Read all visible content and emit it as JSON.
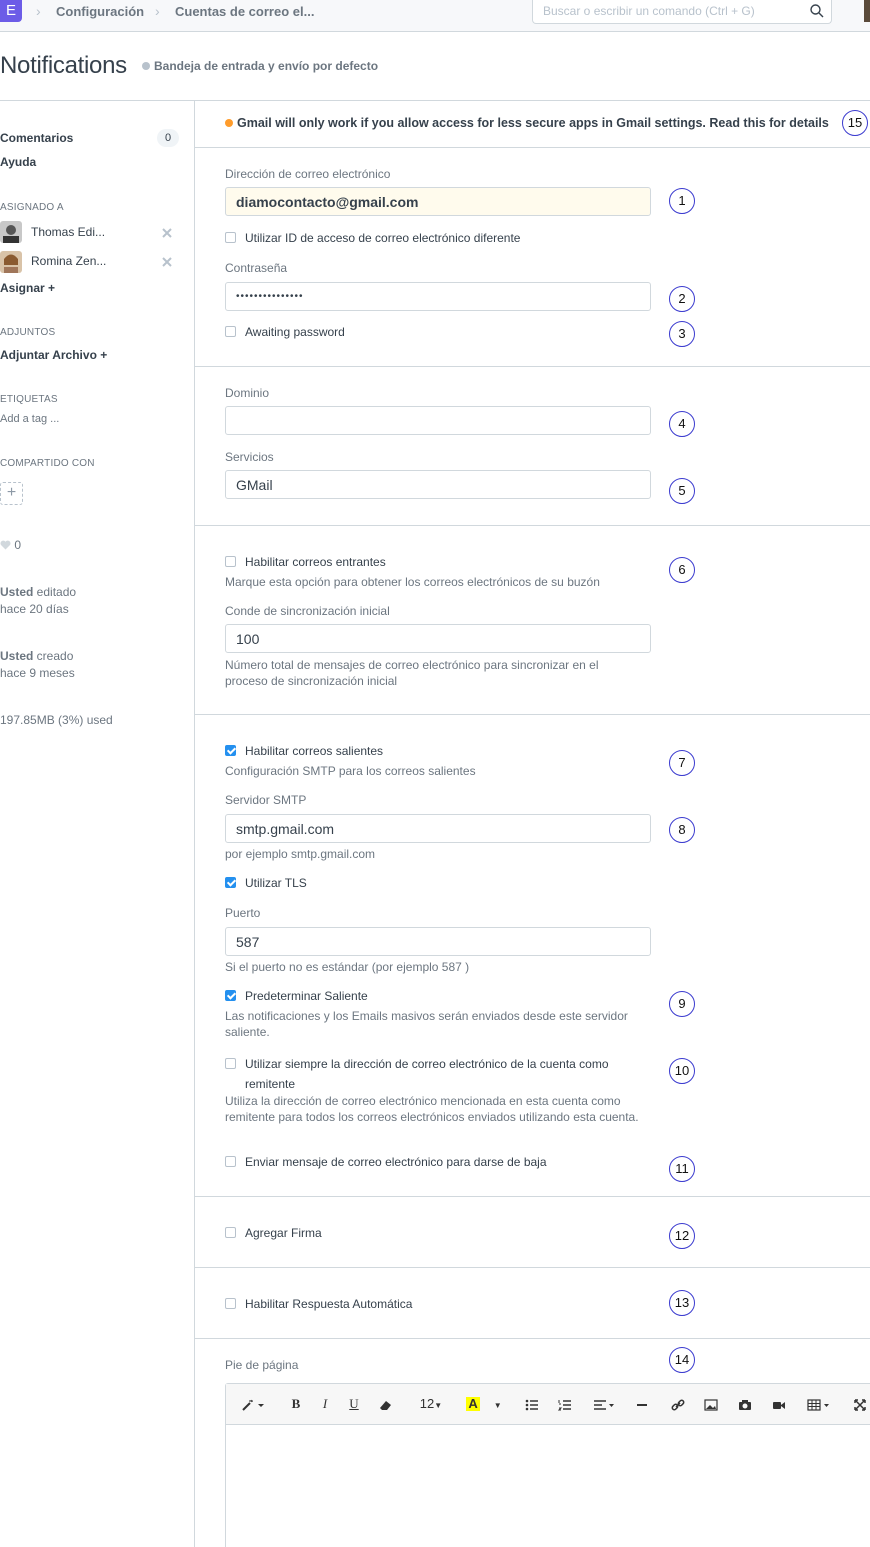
{
  "navbar": {
    "logo": "E",
    "breadcrumbs": [
      "Configuración",
      "Cuentas de correo el..."
    ],
    "search_placeholder": "Buscar o escribir un comando (Ctrl + G)"
  },
  "header": {
    "title": "Notifications",
    "status": "Bandeja de entrada y envío por defecto"
  },
  "sidebar": {
    "comments_label": "Comentarios",
    "comments_count": "0",
    "help_label": "Ayuda",
    "assigned_label": "ASIGNADO A",
    "assignees": [
      "Thomas Edi...",
      "Romina Zen..."
    ],
    "assign_label": "Asignar +",
    "attachments_label": "ADJUNTOS",
    "attach_label": "Adjuntar Archivo +",
    "tags_label": "ETIQUETAS",
    "add_tag": "Add a tag ...",
    "shared_label": "COMPARTIDO CON",
    "share_add": "+",
    "likes": "0",
    "edited_by": "Usted",
    "edited_word": " editado",
    "edited_when": "hace 20 días",
    "created_by": "Usted",
    "created_word": " creado",
    "created_when": "hace 9 meses",
    "storage": "197.85MB (3%) used"
  },
  "alert": "Gmail will only work if you allow access for less secure apps in Gmail settings. Read this for details",
  "form": {
    "email_label": "Dirección de correo electrónico",
    "email_value": "diamocontacto@gmail.com",
    "diff_login_label": "Utilizar ID de acceso de correo electrónico diferente",
    "password_label": "Contraseña",
    "password_value": "•••••••••••••••",
    "awaiting_label": "Awaiting password",
    "domain_label": "Dominio",
    "domain_value": "",
    "service_label": "Servicios",
    "service_value": "GMail",
    "incoming_label": "Habilitar correos entrantes",
    "incoming_help": "Marque esta opción para obtener los correos electrónicos de su buzón",
    "sync_label": "Conde de sincronización inicial",
    "sync_value": "100",
    "sync_help": "Número total de mensajes de correo electrónico para sincronizar en el proceso de sincronización inicial",
    "outgoing_label": "Habilitar correos salientes",
    "outgoing_help": "Configuración SMTP para los correos salientes",
    "smtp_label": "Servidor SMTP",
    "smtp_value": "smtp.gmail.com",
    "smtp_help": "por ejemplo smtp.gmail.com",
    "tls_label": "Utilizar TLS",
    "port_label": "Puerto",
    "port_value": "587",
    "port_help": "Si el puerto no es estándar (por ejemplo 587 )",
    "default_out_label": "Predeterminar Saliente",
    "default_out_help": "Las notificaciones y los Emails masivos serán enviados desde este servidor saliente.",
    "always_sender_label": "Utilizar siempre la dirección de correo electrónico de la cuenta como remitente",
    "always_sender_help": "Utiliza la dirección de correo electrónico mencionada en esta cuenta como remitente para todos los correos electrónicos enviados utilizando esta cuenta.",
    "unsubscribe_label": "Enviar mensaje de correo electrónico para darse de baja",
    "signature_label": "Agregar Firma",
    "auto_reply_label": "Habilitar Respuesta Automática",
    "footer_label": "Pie de página"
  },
  "editor": {
    "font_size": "12",
    "bold": "B",
    "italic": "I",
    "underline": "U",
    "highlight": "A"
  },
  "annotations": [
    "1",
    "2",
    "3",
    "4",
    "5",
    "6",
    "7",
    "8",
    "9",
    "10",
    "11",
    "12",
    "13",
    "14",
    "15"
  ],
  "colors": {
    "accent": "#2490ef",
    "warning": "#ff9c2b",
    "annotation_ring": "#3b3bcf",
    "logo": "#6c5ce7"
  }
}
